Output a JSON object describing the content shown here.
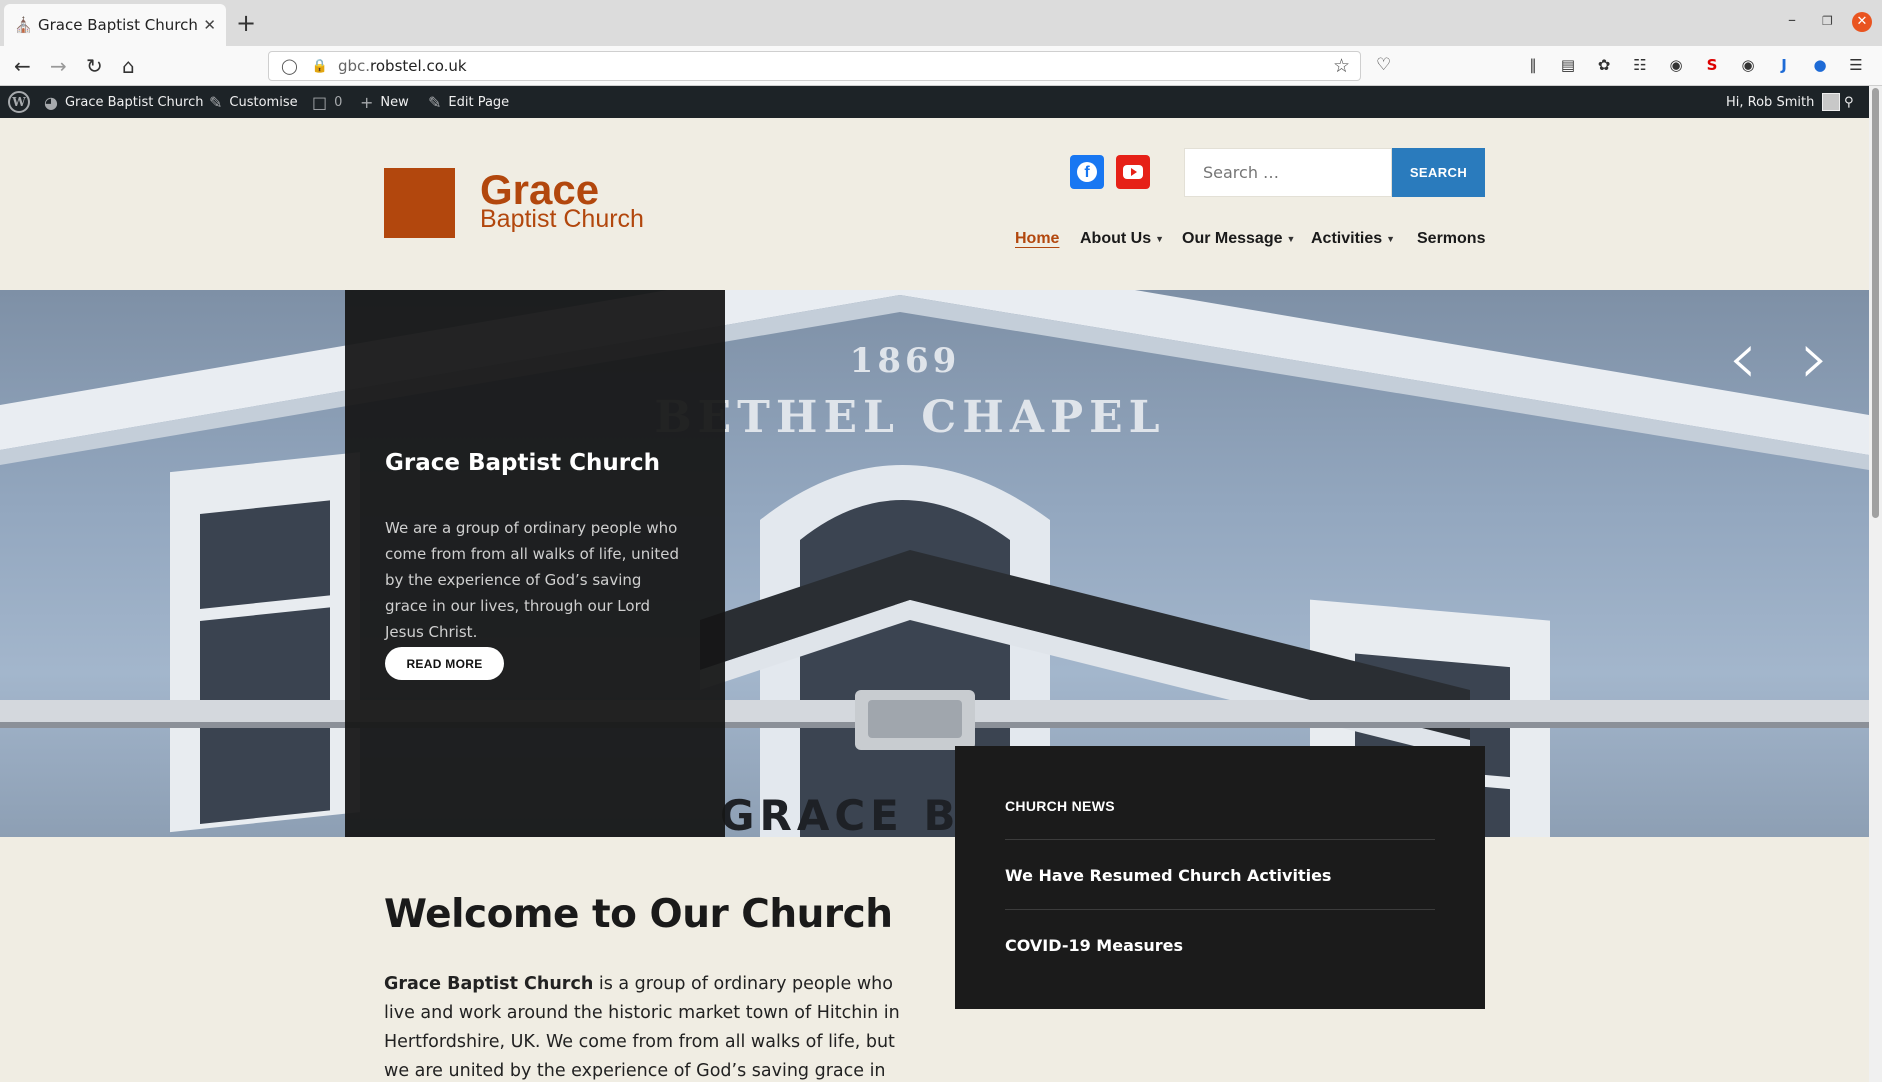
{
  "browser": {
    "tab_title": "Grace Baptist Church",
    "new_tab": "+",
    "url_prefix": "gbc.",
    "url_domain": "robstel.co.uk",
    "toolbar_icons": [
      "library-icon",
      "sidebar-icon",
      "extension-icon",
      "extension-icon",
      "extension-icon",
      "extension-icon",
      "extension-icon",
      "extension-icon",
      "extension-icon",
      "menu-icon"
    ]
  },
  "adminbar": {
    "site_name": "Grace Baptist Church",
    "customise": "Customise",
    "comments_count": "0",
    "new": "New",
    "edit_page": "Edit Page",
    "greeting": "Hi, Rob Smith"
  },
  "header": {
    "logo_title": "Grace",
    "logo_subtitle": "Baptist Church",
    "search_placeholder": "Search …",
    "search_button": "SEARCH",
    "social": [
      "facebook-icon",
      "youtube-icon"
    ],
    "menu": [
      {
        "label": "Home",
        "active": true
      },
      {
        "label": "About Us",
        "dropdown": true
      },
      {
        "label": "Our Message",
        "dropdown": true
      },
      {
        "label": "Activities",
        "dropdown": true
      },
      {
        "label": "Sermons"
      }
    ]
  },
  "hero": {
    "title": "Grace Baptist Church",
    "text": "We are a group of ordinary people who come from from all walks of life, united by the experience of God’s saving grace in our lives, through our Lord Jesus Christ.",
    "button": "READ MORE",
    "image_text": {
      "year": "1869",
      "chapel": "BETHEL CHAPEL",
      "sign": "GRACE BAPTIS"
    }
  },
  "welcome": {
    "title": "Welcome to Our Church",
    "text_bold": "Grace Baptist Church",
    "text_rest": " is a group of ordinary people who live and work around the historic market town of Hitchin in Hertfordshire, UK. We come from from all walks of life, but we are united by the experience of God’s saving grace in our lives"
  },
  "news": {
    "heading": "CHURCH NEWS",
    "items": [
      "We Have Resumed Church Activities",
      "COVID-19 Measures"
    ]
  },
  "colors": {
    "brand": "#b2470d",
    "search_button": "#2a7bbd",
    "facebook": "#1877f2",
    "youtube": "#e62117",
    "adminbar": "#1d2327",
    "page_bg": "#f0ede3"
  }
}
